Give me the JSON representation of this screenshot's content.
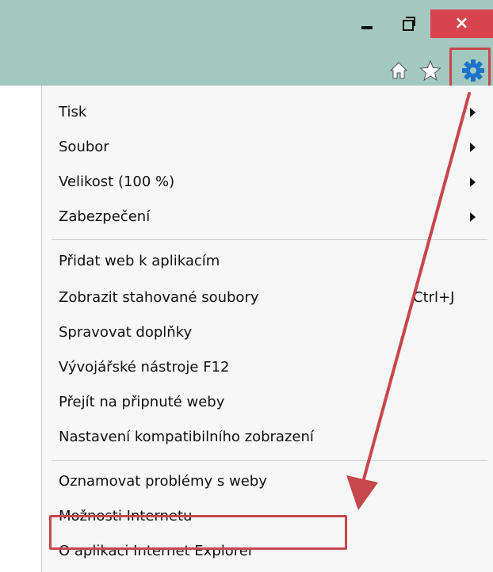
{
  "window": {
    "minimize_icon": "minimize-icon",
    "maximize_icon": "restore-icon",
    "close_label": "×"
  },
  "toolbar": {
    "icons": [
      "home-icon",
      "star-icon",
      "gear-icon"
    ],
    "home_glyph": "⌂",
    "star_glyph": "★"
  },
  "menu": {
    "group1": [
      {
        "label": "Tisk",
        "submenu": true
      },
      {
        "label": "Soubor",
        "submenu": true
      },
      {
        "label": "Velikost (100 %)",
        "submenu": true
      },
      {
        "label": "Zabezpečení",
        "submenu": true
      }
    ],
    "group2": [
      {
        "label": "Přidat web k aplikacím"
      },
      {
        "label": "Zobrazit stahované soubory",
        "shortcut": "Ctrl+J"
      },
      {
        "label": "Spravovat doplňky"
      },
      {
        "label": "Vývojářské nástroje F12"
      },
      {
        "label": "Přejít na připnuté weby"
      },
      {
        "label": "Nastavení kompatibilního zobrazení"
      }
    ],
    "group3": [
      {
        "label": "Oznamovat problémy s weby"
      },
      {
        "label": "Možnosti Internetu"
      },
      {
        "label": "O aplikaci Internet Explorer"
      }
    ]
  },
  "colors": {
    "titlebar": "#a3c8bf",
    "close_button": "#d9434d",
    "annotation": "#c6474c",
    "gear": "#1a73c8"
  }
}
